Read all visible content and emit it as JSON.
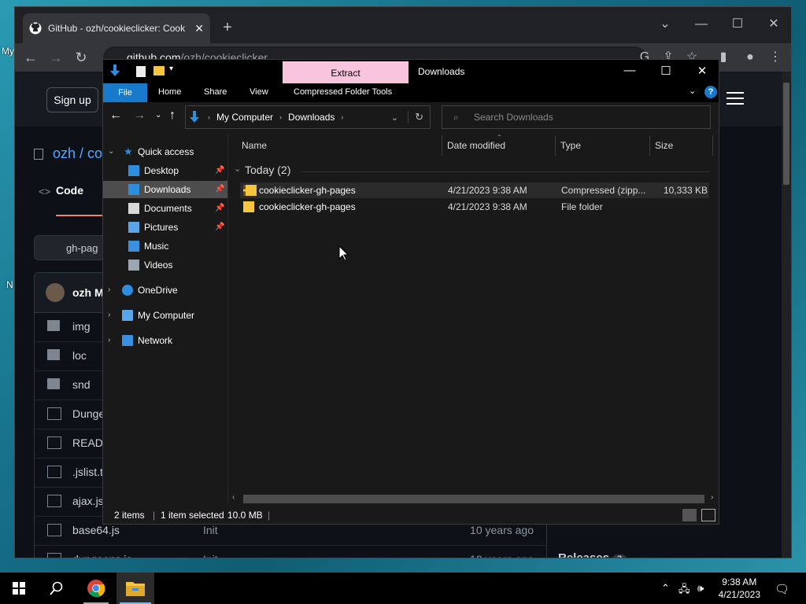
{
  "desktop": {
    "labels": [
      "My",
      "N"
    ]
  },
  "chrome": {
    "tab_title": "GitHub - ozh/cookieclicker: Cook",
    "new_tab": "+",
    "url_host": "github.com",
    "url_path": "/ozh/cookieclicker"
  },
  "github": {
    "signup_label": "Sign up",
    "repo_owner": "ozh / co",
    "code_tab": "Code",
    "branch": "gh-pag",
    "commit_author": "ozh M",
    "files": [
      {
        "name": "img",
        "type": "folder",
        "msg": "",
        "age": ""
      },
      {
        "name": "loc",
        "type": "folder",
        "msg": "",
        "age": ""
      },
      {
        "name": "snd",
        "type": "folder",
        "msg": "",
        "age": ""
      },
      {
        "name": "Dunge",
        "type": "file",
        "msg": "",
        "age": ""
      },
      {
        "name": "READM",
        "type": "file",
        "msg": "",
        "age": ""
      },
      {
        "name": ".jslist.t",
        "type": "file",
        "msg": "",
        "age": ""
      },
      {
        "name": "ajax.js",
        "type": "file",
        "msg": "",
        "age": ""
      },
      {
        "name": "base64.js",
        "type": "file",
        "msg": "Init",
        "age": "10 years ago"
      },
      {
        "name": "dungeons.js",
        "type": "file",
        "msg": "Init",
        "age": "10 years ago"
      }
    ],
    "releases_label": "Releases",
    "releases_count": "3"
  },
  "explorer": {
    "title": "Downloads",
    "contextual_tab": "Extract",
    "ribbon_tabs": [
      "File",
      "Home",
      "Share",
      "View",
      "Compressed Folder Tools"
    ],
    "address": {
      "root": "My Computer",
      "folder": "Downloads"
    },
    "search_placeholder": "Search Downloads",
    "nav": {
      "quick_access": "Quick access",
      "items": [
        {
          "label": "Desktop",
          "pinned": true,
          "icon": "desktop-icon",
          "color": "#2d8ee0"
        },
        {
          "label": "Downloads",
          "pinned": true,
          "icon": "downloads-icon",
          "color": "#2d8ee0",
          "selected": true
        },
        {
          "label": "Documents",
          "pinned": true,
          "icon": "documents-icon",
          "color": "#d9d9d9"
        },
        {
          "label": "Pictures",
          "pinned": true,
          "icon": "pictures-icon",
          "color": "#5aa6e8"
        },
        {
          "label": "Music",
          "pinned": false,
          "icon": "music-icon",
          "color": "#3b8fe0"
        },
        {
          "label": "Videos",
          "pinned": false,
          "icon": "videos-icon",
          "color": "#9aa6b2"
        }
      ],
      "roots": [
        {
          "label": "OneDrive",
          "icon": "onedrive-icon"
        },
        {
          "label": "My Computer",
          "icon": "computer-icon"
        },
        {
          "label": "Network",
          "icon": "network-icon"
        }
      ]
    },
    "columns": [
      "Name",
      "Date modified",
      "Type",
      "Size"
    ],
    "group": "Today (2)",
    "files": [
      {
        "name": "cookieclicker-gh-pages",
        "date": "4/21/2023 9:38 AM",
        "type": "Compressed (zipp...",
        "size": "10,333 KB",
        "icon": "zip-folder-icon",
        "selected": true
      },
      {
        "name": "cookieclicker-gh-pages",
        "date": "4/21/2023 9:38 AM",
        "type": "File folder",
        "size": "",
        "icon": "folder-icon",
        "selected": false
      }
    ],
    "status": {
      "items": "2 items",
      "selected": "1 item selected",
      "size": "10.0 MB"
    }
  },
  "taskbar": {
    "time": "9:38 AM",
    "date": "4/21/2023"
  },
  "colors": {
    "explorer_accent": "#1979ca",
    "extract_tab": "#f9c4dd",
    "folder": "#f5c542"
  }
}
